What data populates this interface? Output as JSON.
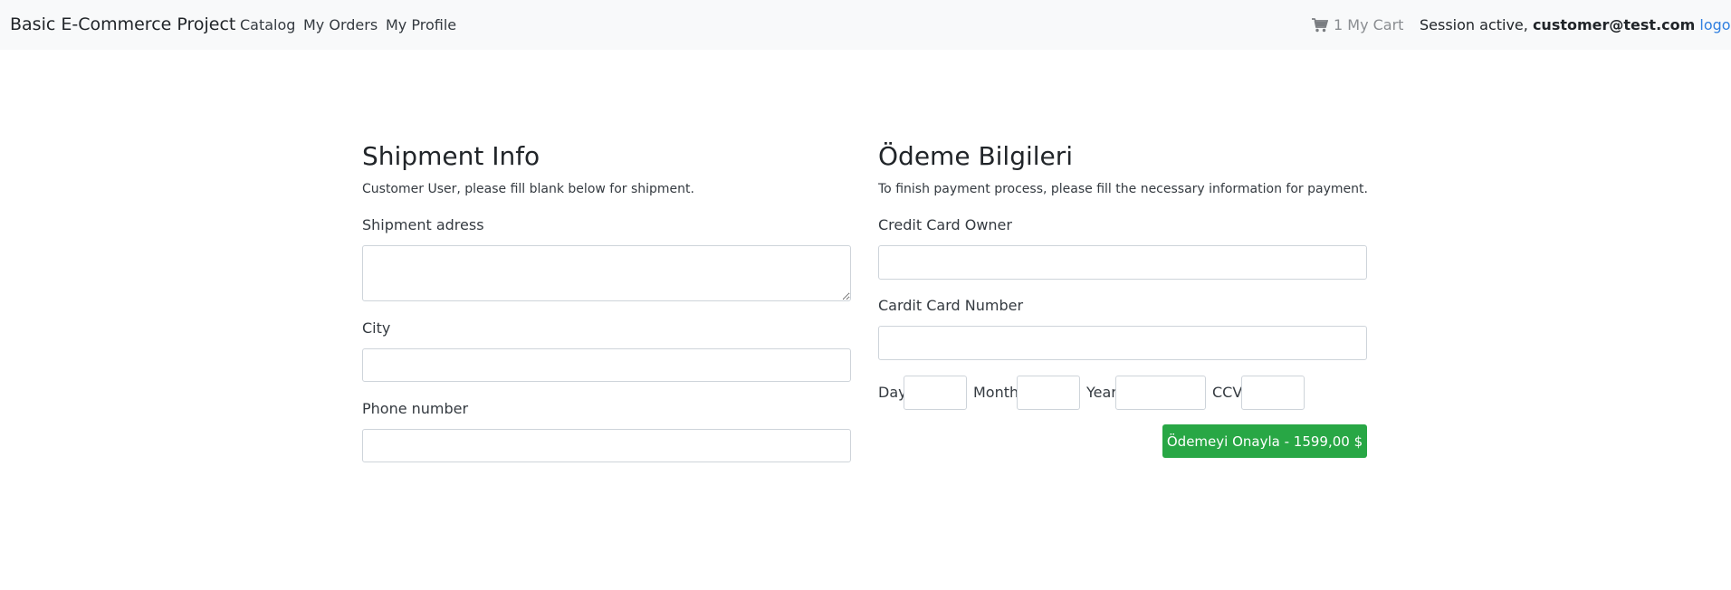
{
  "navbar": {
    "brand": "Basic E-Commerce Project",
    "links": [
      "Catalog",
      "My Orders",
      "My Profile"
    ],
    "cart_label": "1 My Cart",
    "session_prefix": "Session active, ",
    "session_user": "customer@test.com",
    "logout_label": "logout."
  },
  "shipment": {
    "title": "Shipment Info",
    "description": "Customer User, please fill blank below for shipment.",
    "address_label": "Shipment adress",
    "address_value": "",
    "city_label": "City",
    "city_value": "",
    "phone_label": "Phone number",
    "phone_value": ""
  },
  "payment": {
    "title": "Ödeme Bilgileri",
    "description": "To finish payment process, please fill the necessary information for payment.",
    "owner_label": "Credit Card Owner",
    "owner_value": "",
    "number_label": "Cardit Card Number",
    "number_value": "",
    "day_label": "Day",
    "month_label": "Month",
    "year_label": "Year",
    "ccv_label": "CCV",
    "submit_label": "Ödemeyi Onayla - 1599,00 $"
  },
  "colors": {
    "navbar_bg": "#f8f9fa",
    "accent_link": "#2f7fe0",
    "submit_bg": "#28a745"
  },
  "icons": {
    "cart": "shopping-cart-icon"
  }
}
